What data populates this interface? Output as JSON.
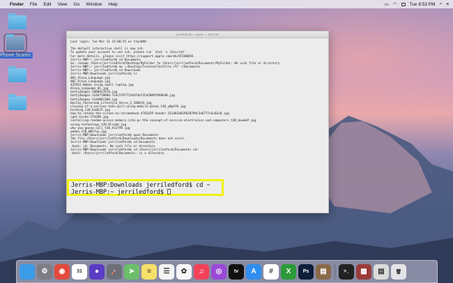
{
  "menubar": {
    "apple": "",
    "items": [
      "Finder",
      "File",
      "Edit",
      "View",
      "Go",
      "Window",
      "Help"
    ],
    "clock": "Tue 8:53 PM"
  },
  "desktop": {
    "icons": [
      {
        "label": "",
        "selected": false
      },
      {
        "label": "Phone Scams",
        "selected": true
      },
      {
        "label": "",
        "selected": false
      },
      {
        "label": "",
        "selected": false
      }
    ]
  },
  "terminal": {
    "title": "jerriledford — bash — 157×40",
    "lines": [
      "Last login: Tue Mar 31 21:00:55 on ttys000",
      "",
      "The default interactive shell is now zsh.",
      "To update your account to use zsh, please run `chsh -s /bin/zsh`.",
      "For more details, please visit https://support.apple.com/kb/HT208050.",
      "Jerris-MBP:~ jerriledford$ cd Documents",
      "mv: rename /Users/jerriledford/Desktop/MyFolder to /Users/jerriledford/Documents/MyFolder: No such file or directory",
      "Jerris-MBP:~ jerriledford$ mv ~/Desktop/TerminalTestFile.rtf ~/Documents",
      "Jerris-MBP:~ jerriledford$ cd Downloads",
      "Jerris-MBP:Downloads jerriledford$ ls",
      "001_Alexa_Language.jpg",
      "002_Alexa_Language.jpg",
      "4355b1 Woman using small laptop.jpg",
      "Alexa_Language_01.jpg",
      "GettyImages-1000937678.jpg",
      "GettyImages-1144778866-7c6c5797715d4f4af35a5009f098b40.jpg",
      "GettyImages-1144861300.jpg",
      "Hailey_Pasternak_Lifestyle_Verso_2_188619.jpg",
      "closeup-of-a-serious-teen-girl-using-mobile-phone_t20_yBpXf6.jpg",
      "holding_t20_Ea8GJY.jpg",
      "how-to-rotate-the-screen-on-chromebook-4783429-header-3514834029628799c3a6777c6c02e0.jpg",
      "iget-hiske-174209.jpg",
      "installing-random-access-memory-into-pc-the-concept-of-service-electronics-and-computers_t20_bxwmeP.jpg",
      "using-technology_t20_Rlinmk.jpg",
      "why-you-gonna-call_t20_A11T99.jpg",
      "woman_t20_WB17vw.jpg",
      "Jerris-MBP:Downloads jerriledford$ open Documents",
      "The file /Users/jerriledford/Downloads/Documents does not exist.",
      "Jerris-MBP:Downloads jerriledford$ cd Documents",
      "-bash: cd: Documents: No such file or directory",
      "Jerris-MBP:Downloads jerriledford$ cd /Users/jerriledford/Documents cd~",
      "-bash: /Users/jerriledford/Documents: is a directory"
    ],
    "highlight_line1": "Jerris-MBP:Downloads jerriledford$ cd ~",
    "highlight_line2": "Jerris-MBP:~ jerriledford$ "
  },
  "dock": {
    "apps": [
      {
        "name": "finder-icon",
        "color": "#3b9be8",
        "glyph": ""
      },
      {
        "name": "system-preferences-icon",
        "color": "#7d7d85",
        "glyph": "⚙"
      },
      {
        "name": "chrome-icon",
        "color": "#e24a3b",
        "glyph": "◉"
      },
      {
        "name": "calendar-icon",
        "color": "#ffffff",
        "glyph": "31"
      },
      {
        "name": "siri-icon",
        "color": "#5b3cc4",
        "glyph": "●"
      },
      {
        "name": "launchpad-icon",
        "color": "#6c7078",
        "glyph": "🚀"
      },
      {
        "name": "maps-icon",
        "color": "#6cbf6a",
        "glyph": "➤"
      },
      {
        "name": "notes-icon",
        "color": "#f6e06a",
        "glyph": "≡"
      },
      {
        "name": "reminders-icon",
        "color": "#f4f4f4",
        "glyph": "☰"
      },
      {
        "name": "photos-icon",
        "color": "#f7f7f7",
        "glyph": "✿"
      },
      {
        "name": "music-icon",
        "color": "#f3415a",
        "glyph": "♫"
      },
      {
        "name": "podcasts-icon",
        "color": "#9a4ad6",
        "glyph": "◎"
      },
      {
        "name": "apple-tv-icon",
        "color": "#111111",
        "glyph": "tv"
      },
      {
        "name": "app-store-icon",
        "color": "#2f8ef0",
        "glyph": "A"
      },
      {
        "name": "slack-icon",
        "color": "#ffffff",
        "glyph": "#"
      },
      {
        "name": "xbox-icon",
        "color": "#2c9a3a",
        "glyph": "X"
      },
      {
        "name": "photoshop-icon",
        "color": "#0d1e3a",
        "glyph": "Ps"
      },
      {
        "name": "notebook-icon",
        "color": "#8a6a4a",
        "glyph": "▤"
      },
      {
        "name": "terminal-icon",
        "color": "#222222",
        "glyph": ">_"
      },
      {
        "name": "downloads-stack-icon",
        "color": "#9a3b3b",
        "glyph": "▦"
      },
      {
        "name": "documents-stack-icon",
        "color": "#dcdcdc",
        "glyph": "▤"
      },
      {
        "name": "trash-icon",
        "color": "#e4e4e8",
        "glyph": "🗑"
      }
    ]
  }
}
